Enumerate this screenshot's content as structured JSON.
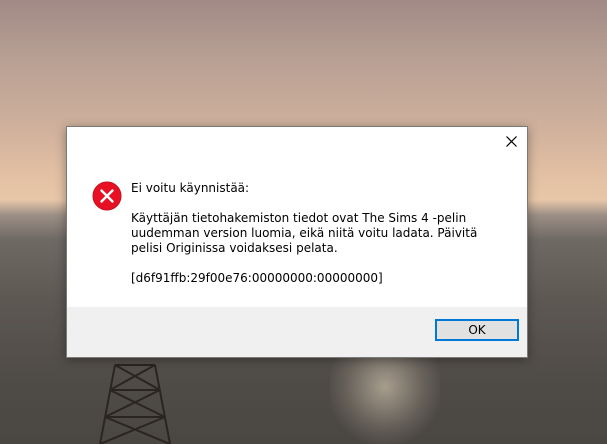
{
  "wallpaper": {
    "description_icon": "sunset-sea-wallpaper"
  },
  "dialog": {
    "close_icon": "close-icon",
    "error_icon": "error-icon",
    "title": "Ei voitu käynnistää:",
    "body": "Käyttäjän tietohakemiston tiedot ovat The Sims 4 -pelin uudemman version luomia, eikä niitä voitu ladata. Päivitä pelisi Originissa voidaksesi pelata.",
    "code": "[d6f91ffb:29f00e76:00000000:00000000]",
    "ok_label": "OK"
  },
  "colors": {
    "error_red": "#e81123",
    "focus_blue": "#0078d7",
    "footer_gray": "#f0f0f0"
  }
}
